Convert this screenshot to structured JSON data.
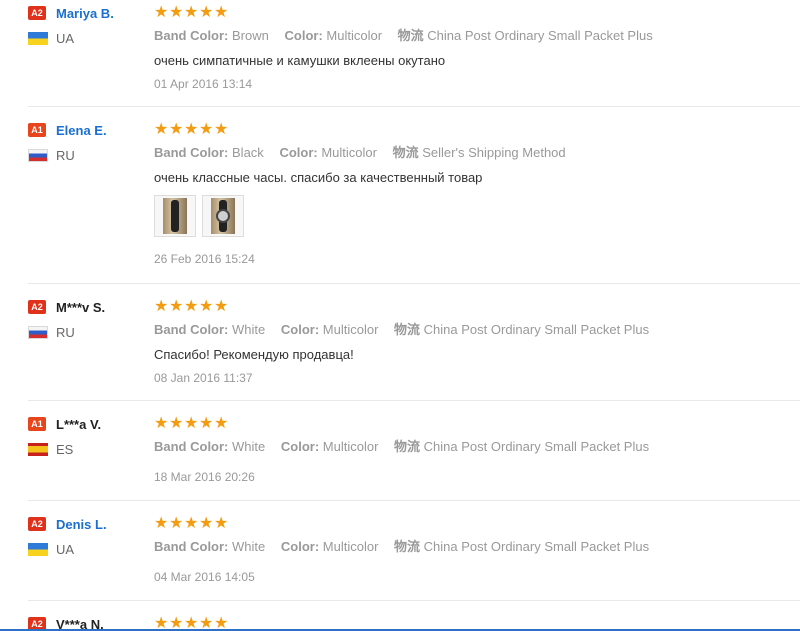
{
  "reviews": [
    {
      "level": "A2",
      "name": "Mariya B.",
      "country": "UA",
      "attrs": [
        {
          "label": "Band Color:",
          "value": "Brown"
        },
        {
          "label": "Color:",
          "value": "Multicolor"
        },
        {
          "label": "物流",
          "value": "China Post Ordinary Small Packet Plus"
        }
      ],
      "text": "очень симпатичные и камушки вклеены окутано",
      "date": "01 Apr 2016 13:14"
    },
    {
      "level": "A1",
      "name": "Elena E.",
      "country": "RU",
      "attrs": [
        {
          "label": "Band Color:",
          "value": "Black"
        },
        {
          "label": "Color:",
          "value": "Multicolor"
        },
        {
          "label": "物流",
          "value": "Seller's Shipping Method"
        }
      ],
      "text": "очень классные часы. спасибо за качественный товар",
      "date": "26 Feb 2016 15:24"
    },
    {
      "level": "A2",
      "name": "M***v S.",
      "country": "RU",
      "attrs": [
        {
          "label": "Band Color:",
          "value": "White"
        },
        {
          "label": "Color:",
          "value": "Multicolor"
        },
        {
          "label": "物流",
          "value": "China Post Ordinary Small Packet Plus"
        }
      ],
      "text": "Спасибо! Рекомендую продавца!",
      "date": "08 Jan 2016 11:37"
    },
    {
      "level": "A1",
      "name": "L***a V.",
      "country": "ES",
      "attrs": [
        {
          "label": "Band Color:",
          "value": "White"
        },
        {
          "label": "Color:",
          "value": "Multicolor"
        },
        {
          "label": "物流",
          "value": "China Post Ordinary Small Packet Plus"
        }
      ],
      "text": "",
      "date": "18 Mar 2016 20:26"
    },
    {
      "level": "A2",
      "name": "Denis L.",
      "country": "UA",
      "attrs": [
        {
          "label": "Band Color:",
          "value": "White"
        },
        {
          "label": "Color:",
          "value": "Multicolor"
        },
        {
          "label": "物流",
          "value": "China Post Ordinary Small Packet Plus"
        }
      ],
      "text": "",
      "date": "04 Mar 2016 14:05"
    },
    {
      "level": "A2",
      "name": "V***a N.",
      "country": "",
      "attrs": [],
      "text": "",
      "date": ""
    }
  ],
  "ratings": [
    5,
    5,
    5,
    5,
    5,
    5
  ],
  "colors": {
    "star": "#f39c12",
    "link": "#1a6fd0",
    "badge": "#e0321b"
  }
}
